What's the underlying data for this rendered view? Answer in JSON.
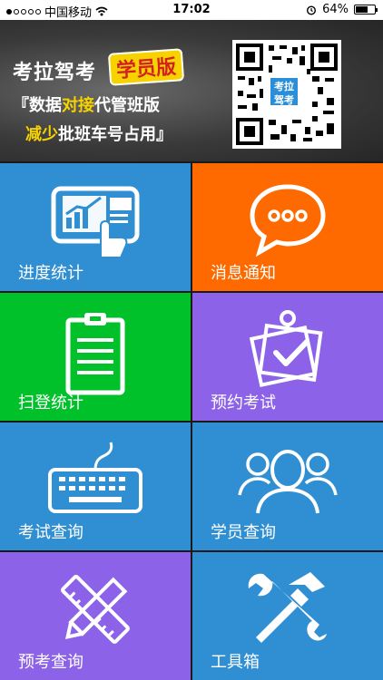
{
  "status_bar": {
    "carrier": "中国移动",
    "time": "17:02",
    "battery": "64%",
    "battery_level": 0.64
  },
  "banner": {
    "title": "考拉驾考",
    "badge": "学员版",
    "line1_a": "『数据",
    "line1_hl": "对接",
    "line1_b": "代管班版",
    "line2_hl": "减少",
    "line2_b": "批班车号占用』",
    "qr_label_1": "考拉",
    "qr_label_2": "驾考"
  },
  "tiles": [
    {
      "label": "进度统计",
      "color": "#2f8fd2",
      "icon": "progress-chart-icon"
    },
    {
      "label": "消息通知",
      "color": "#ff6a00",
      "icon": "message-bubble-icon"
    },
    {
      "label": "扫登统计",
      "color": "#00c12a",
      "icon": "clipboard-icon"
    },
    {
      "label": "预约考试",
      "color": "#8c62e8",
      "icon": "appointment-check-icon"
    },
    {
      "label": "考试查询",
      "color": "#2f8fd2",
      "icon": "keyboard-icon"
    },
    {
      "label": "学员查询",
      "color": "#2f8fd2",
      "icon": "users-icon"
    },
    {
      "label": "预考查询",
      "color": "#8c62e8",
      "icon": "pencil-ruler-icon"
    },
    {
      "label": "工具箱",
      "color": "#2f8fd2",
      "icon": "tools-icon"
    }
  ]
}
